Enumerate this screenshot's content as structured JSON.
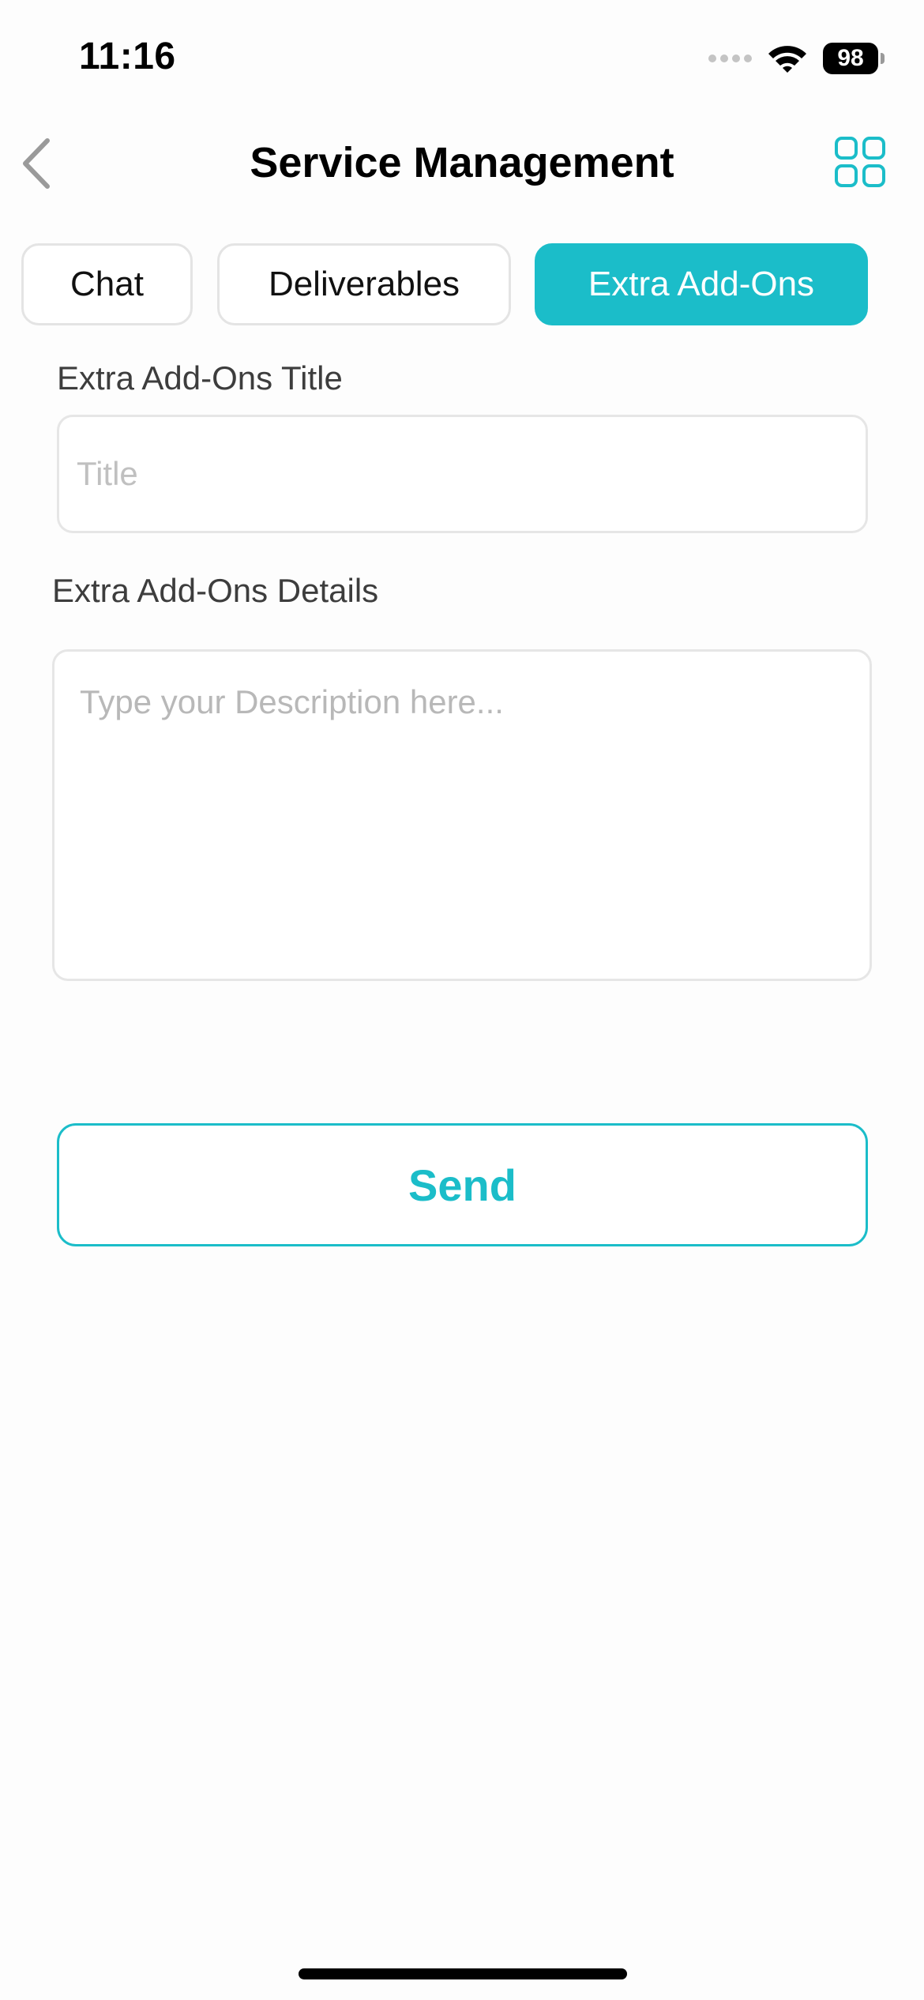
{
  "status_bar": {
    "time": "11:16",
    "battery": "98",
    "icons": [
      "signal-icon",
      "wifi-icon",
      "battery-icon"
    ]
  },
  "header": {
    "title": "Service Management",
    "back_icon": "chevron-left-icon",
    "menu_icon": "grid-icon"
  },
  "tabs": [
    {
      "label": "Chat",
      "active": false
    },
    {
      "label": "Deliverables",
      "active": false
    },
    {
      "label": "Extra Add-Ons",
      "active": true
    }
  ],
  "form": {
    "title_label": "Extra Add-Ons Title",
    "title_value": "",
    "title_placeholder": "Title",
    "details_label": "Extra Add-Ons Details",
    "details_value": "",
    "details_placeholder": "Type your Description here..."
  },
  "actions": {
    "send_label": "Send"
  },
  "colors": {
    "accent": "#1bbdc9",
    "background": "#fdfdfd",
    "border": "#e4e4e4",
    "label_text": "#3d3d3d",
    "placeholder": "#c0c0c0"
  }
}
